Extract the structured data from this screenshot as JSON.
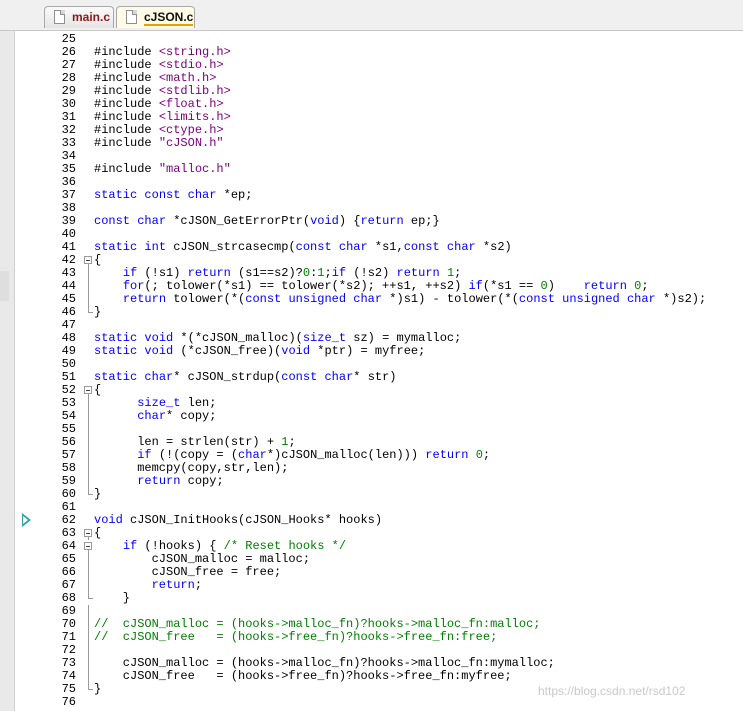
{
  "tabs": [
    {
      "label": "main.c",
      "active": false,
      "icon": "c-file-icon"
    },
    {
      "label": "cJSON.c",
      "active": true,
      "icon": "c-file-icon"
    }
  ],
  "colors": {
    "keyword": "#0000ff",
    "string": "#800080",
    "comment": "#008000",
    "number": "#008000",
    "text": "#000000"
  },
  "watermark": "https://blog.csdn.net/rsd102",
  "editor": {
    "bookmark_line": "62",
    "lines": [
      {
        "n": "25",
        "t": ""
      },
      {
        "n": "26",
        "t": "#include <string.h>"
      },
      {
        "n": "27",
        "t": "#include <stdio.h>"
      },
      {
        "n": "28",
        "t": "#include <math.h>"
      },
      {
        "n": "29",
        "t": "#include <stdlib.h>"
      },
      {
        "n": "30",
        "t": "#include <float.h>"
      },
      {
        "n": "31",
        "t": "#include <limits.h>"
      },
      {
        "n": "32",
        "t": "#include <ctype.h>"
      },
      {
        "n": "33",
        "t": "#include \"cJSON.h\""
      },
      {
        "n": "34",
        "t": ""
      },
      {
        "n": "35",
        "t": "#include \"malloc.h\""
      },
      {
        "n": "36",
        "t": ""
      },
      {
        "n": "37",
        "t": "static const char *ep;"
      },
      {
        "n": "38",
        "t": ""
      },
      {
        "n": "39",
        "t": "const char *cJSON_GetErrorPtr(void) {return ep;}"
      },
      {
        "n": "40",
        "t": ""
      },
      {
        "n": "41",
        "t": "static int cJSON_strcasecmp(const char *s1,const char *s2)"
      },
      {
        "n": "42",
        "t": "{",
        "fold": "open"
      },
      {
        "n": "43",
        "t": "    if (!s1) return (s1==s2)?0:1;if (!s2) return 1;",
        "fold": "bar"
      },
      {
        "n": "44",
        "t": "    for(; tolower(*s1) == tolower(*s2); ++s1, ++s2) if(*s1 == 0)    return 0;",
        "fold": "bar"
      },
      {
        "n": "45",
        "t": "    return tolower(*(const unsigned char *)s1) - tolower(*(const unsigned char *)s2);",
        "fold": "bar"
      },
      {
        "n": "46",
        "t": "}",
        "fold": "end"
      },
      {
        "n": "47",
        "t": ""
      },
      {
        "n": "48",
        "t": "static void *(*cJSON_malloc)(size_t sz) = mymalloc;"
      },
      {
        "n": "49",
        "t": "static void (*cJSON_free)(void *ptr) = myfree;"
      },
      {
        "n": "50",
        "t": ""
      },
      {
        "n": "51",
        "t": "static char* cJSON_strdup(const char* str)"
      },
      {
        "n": "52",
        "t": "{",
        "fold": "open"
      },
      {
        "n": "53",
        "t": "      size_t len;",
        "fold": "bar"
      },
      {
        "n": "54",
        "t": "      char* copy;",
        "fold": "bar"
      },
      {
        "n": "55",
        "t": "",
        "fold": "bar"
      },
      {
        "n": "56",
        "t": "      len = strlen(str) + 1;",
        "fold": "bar"
      },
      {
        "n": "57",
        "t": "      if (!(copy = (char*)cJSON_malloc(len))) return 0;",
        "fold": "bar"
      },
      {
        "n": "58",
        "t": "      memcpy(copy,str,len);",
        "fold": "bar"
      },
      {
        "n": "59",
        "t": "      return copy;",
        "fold": "bar"
      },
      {
        "n": "60",
        "t": "}",
        "fold": "end"
      },
      {
        "n": "61",
        "t": ""
      },
      {
        "n": "62",
        "t": "void cJSON_InitHooks(cJSON_Hooks* hooks)"
      },
      {
        "n": "63",
        "t": "{",
        "fold": "open"
      },
      {
        "n": "64",
        "t": "    if (!hooks) { /* Reset hooks */",
        "fold": "open"
      },
      {
        "n": "65",
        "t": "        cJSON_malloc = malloc;",
        "fold": "bar"
      },
      {
        "n": "66",
        "t": "        cJSON_free = free;",
        "fold": "bar"
      },
      {
        "n": "67",
        "t": "        return;",
        "fold": "bar"
      },
      {
        "n": "68",
        "t": "    }",
        "fold": "end"
      },
      {
        "n": "69",
        "t": "",
        "fold": "bar"
      },
      {
        "n": "70",
        "t": "//  cJSON_malloc = (hooks->malloc_fn)?hooks->malloc_fn:malloc;",
        "fold": "bar"
      },
      {
        "n": "71",
        "t": "//  cJSON_free   = (hooks->free_fn)?hooks->free_fn:free;",
        "fold": "bar"
      },
      {
        "n": "72",
        "t": "",
        "fold": "bar"
      },
      {
        "n": "73",
        "t": "    cJSON_malloc = (hooks->malloc_fn)?hooks->malloc_fn:mymalloc;",
        "fold": "bar"
      },
      {
        "n": "74",
        "t": "    cJSON_free   = (hooks->free_fn)?hooks->free_fn:myfree;",
        "fold": "bar"
      },
      {
        "n": "75",
        "t": "}",
        "fold": "end"
      },
      {
        "n": "76",
        "t": ""
      }
    ]
  }
}
